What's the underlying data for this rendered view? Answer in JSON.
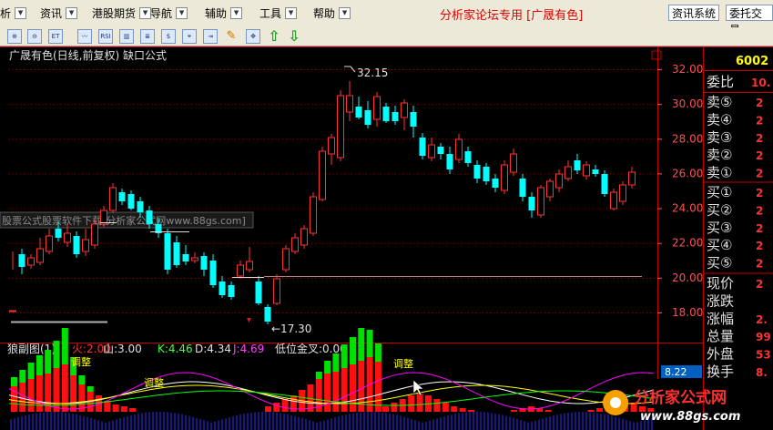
{
  "menu": [
    "析",
    "资讯",
    "港股期货",
    "导航",
    "辅助",
    "工具",
    "帮助"
  ],
  "promo": "分析家论坛专用 [广晟有色]",
  "top_buttons": {
    "info": "资讯系统",
    "trade": "委托交易"
  },
  "chart_title": "广晟有色(日线,前复权) 缺口公式",
  "price_axis": [
    "32.00",
    "30.00",
    "28.00",
    "26.00",
    "24.00",
    "22.00",
    "20.00",
    "18.00"
  ],
  "annotations": {
    "high": "32.15",
    "low": "←17.30"
  },
  "watermark": "股票公式股票软件下载[分析家公式网www.88gs.com]",
  "indicator": {
    "name": "狼副图(1)",
    "huo": "火:2.00",
    "shan": "山:3.00",
    "k": "K:4.46",
    "d": "D:4.34",
    "j": "J:4.69",
    "dwjc": "低位金叉:0.00",
    "label_tiaozheng1": "调整",
    "label_tiaozheng2": "调整",
    "label_tiaozheng3": "调整",
    "value_tag": "8.22"
  },
  "right_panel": {
    "code": "6002",
    "weibi_label": "委比",
    "weibi_value": "10.",
    "rows": [
      {
        "label": "卖⑤",
        "value": "2"
      },
      {
        "label": "卖④",
        "value": "2"
      },
      {
        "label": "卖③",
        "value": "2"
      },
      {
        "label": "卖②",
        "value": "2"
      },
      {
        "label": "卖①",
        "value": "2"
      },
      {
        "label": "买①",
        "value": "2"
      },
      {
        "label": "买②",
        "value": "2"
      },
      {
        "label": "买③",
        "value": "2"
      },
      {
        "label": "买④",
        "value": "2"
      },
      {
        "label": "买⑤",
        "value": "2"
      },
      {
        "label": "现价",
        "value": "2"
      },
      {
        "label": "涨跌",
        "value": ""
      },
      {
        "label": "涨幅",
        "value": "2."
      },
      {
        "label": "总量",
        "value": "99"
      },
      {
        "label": "外盘",
        "value": "53"
      },
      {
        "label": "换手",
        "value": "8."
      }
    ]
  },
  "logo": {
    "text": "分析家公式网",
    "url": "www.88gs.com"
  },
  "colors": {
    "up": "#ff3232",
    "down": "#00ffff",
    "grid": "#800000",
    "axis": "#ff5050",
    "k": "#ffffff",
    "d": "#ffff00",
    "j": "#ff00ff"
  }
}
